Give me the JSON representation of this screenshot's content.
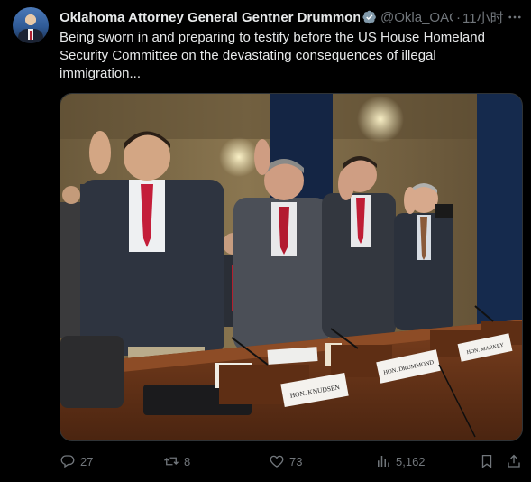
{
  "tweet": {
    "author_name": "Oklahoma Attorney General Gentner Drummond",
    "handle": "@Okla_OAG",
    "separator": "·",
    "time": "11小时",
    "text": "Being sworn in and preparing to testify before the US House Homeland Security Committee on the devastating consequences of illegal immigration..."
  },
  "photo": {
    "nameplates": [
      "HON. KNUDSEN",
      "HON. DRUMMOND",
      "HON. MARKEY"
    ]
  },
  "actions": {
    "replies": "27",
    "reposts": "8",
    "likes": "73",
    "views": "5,162"
  },
  "icons": {
    "verified": "verified-badge-icon",
    "more": "more-icon",
    "reply": "reply-icon",
    "repost": "repost-icon",
    "like": "heart-icon",
    "views": "views-icon",
    "bookmark": "bookmark-icon",
    "share": "share-icon"
  },
  "colors": {
    "background": "#000000",
    "text": "#e7e9ea",
    "secondary": "#71767b",
    "verified": "#829aab"
  }
}
